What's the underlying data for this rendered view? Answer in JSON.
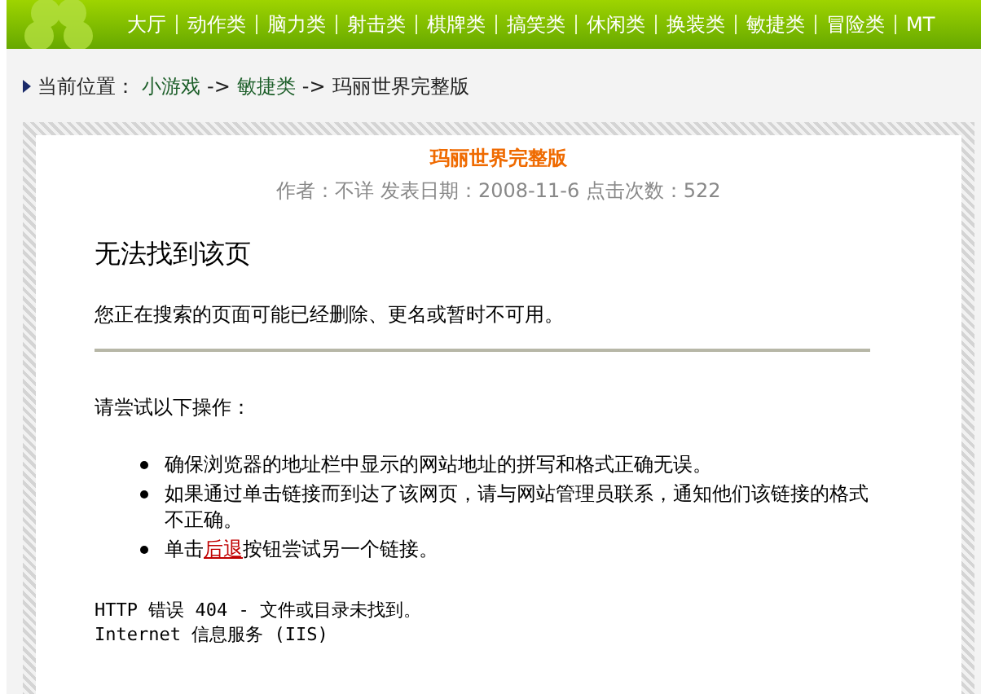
{
  "nav": {
    "items": [
      {
        "label": "大厅"
      },
      {
        "label": "动作类"
      },
      {
        "label": "脑力类"
      },
      {
        "label": "射击类"
      },
      {
        "label": "棋牌类"
      },
      {
        "label": "搞笑类"
      },
      {
        "label": "休闲类"
      },
      {
        "label": "换装类"
      },
      {
        "label": "敏捷类"
      },
      {
        "label": "冒险类"
      },
      {
        "label": "MT"
      }
    ]
  },
  "breadcrumb": {
    "prefix": "当前位置：",
    "links": [
      "小游戏",
      "敏捷类"
    ],
    "separators": [
      "->",
      "->"
    ],
    "current": "玛丽世界完整版"
  },
  "article": {
    "title": "玛丽世界完整版",
    "meta": "作者：不详 发表日期：2008-11-6 点击次数：522"
  },
  "error": {
    "heading": "无法找到该页",
    "message": "您正在搜索的页面可能已经删除、更名或暂时不可用。",
    "try_label": "请尝试以下操作：",
    "steps": [
      {
        "before": "确保浏览器的地址栏中显示的网站地址的拼写和格式正确无误。"
      },
      {
        "before": "如果通过单击链接而到达了该网页，请与网站管理员联系，通知他们该链接的格式不正确。"
      },
      {
        "before": "单击",
        "link": "后退",
        "after": "按钮尝试另一个链接。"
      }
    ],
    "code_lines": [
      "HTTP 错误 404 - 文件或目录未找到。",
      "Internet 信息服务 (IIS)"
    ]
  }
}
